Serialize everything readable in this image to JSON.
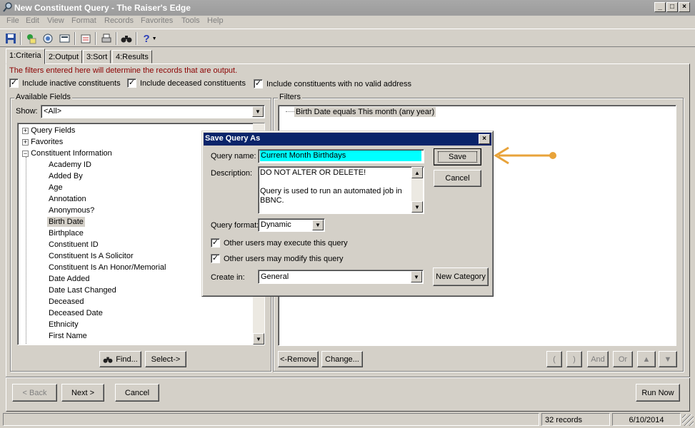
{
  "window": {
    "title": "New Constituent Query - The Raiser's Edge"
  },
  "menu": [
    "File",
    "Edit",
    "View",
    "Format",
    "Records",
    "Favorites",
    "Tools",
    "Help"
  ],
  "tabs": [
    "1:Criteria",
    "2:Output",
    "3:Sort",
    "4:Results"
  ],
  "criteria": {
    "note": "The filters entered here will determine the records that are output.",
    "include_inactive": "Include inactive constituents",
    "include_deceased": "Include deceased constituents",
    "include_no_address": "Include constituents with no valid address"
  },
  "available_fields": {
    "label": "Available Fields",
    "show_label": "Show:",
    "show_value": "<All>",
    "roots": [
      "Query Fields",
      "Favorites",
      "Constituent Information"
    ],
    "items": [
      "Academy ID",
      "Added By",
      "Age",
      "Annotation",
      "Anonymous?",
      "Birth Date",
      "Birthplace",
      "Constituent ID",
      "Constituent Is A Solicitor",
      "Constituent Is An Honor/Memorial",
      "Date Added",
      "Date Last Changed",
      "Deceased",
      "Deceased Date",
      "Ethnicity",
      "First Name"
    ],
    "find_button": "Find...",
    "select_button": "Select->"
  },
  "filters": {
    "label": "Filters",
    "items": [
      "Birth Date equals This month (any year)"
    ],
    "remove_button": "<-Remove",
    "change_button": "Change...",
    "open_paren": "(",
    "close_paren": ")",
    "and_button": "And",
    "or_button": "Or",
    "up_icon": "up-arrow-icon",
    "down_icon": "down-arrow-icon"
  },
  "dialog": {
    "title": "Save Query As",
    "query_name_label": "Query name:",
    "query_name_value": "Current Month Birthdays",
    "description_label": "Description:",
    "description_line1": "DO NOT ALTER OR DELETE!",
    "description_line2": "Query is used to run an automated job in",
    "description_line3": "BBNC.",
    "query_format_label": "Query format:",
    "query_format_value": "Dynamic",
    "execute_label": "Other users may execute this query",
    "modify_label": "Other users may modify this query",
    "create_in_label": "Create in:",
    "create_in_value": "General",
    "save_button": "Save",
    "cancel_button": "Cancel",
    "new_category_button": "New Category",
    "highlight_color": "#00ffff",
    "arrow_color": "#e8a33a"
  },
  "nav": {
    "back_button": "< Back",
    "next_button": "Next >",
    "cancel_button": "Cancel",
    "run_now_button": "Run Now"
  },
  "status": {
    "records": "32 records",
    "date": "6/10/2014"
  }
}
